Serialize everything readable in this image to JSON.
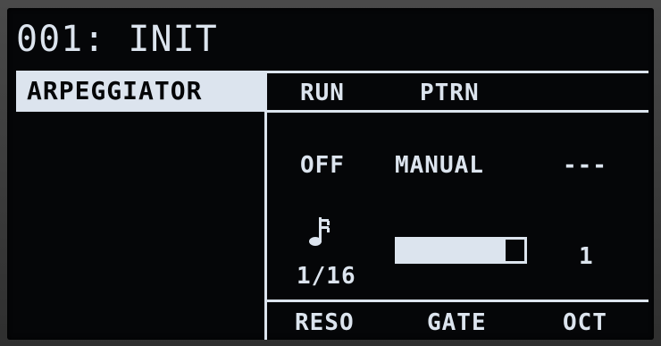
{
  "preset": {
    "title": "001: INIT"
  },
  "section": {
    "label": "ARPEGGIATOR"
  },
  "top_params": {
    "run_label": "RUN",
    "pattern_label": "PTRN",
    "run_value": "OFF",
    "pattern_value": "MANUAL",
    "third_value": "---"
  },
  "bottom_params": {
    "reso_label": "RESO",
    "gate_label": "GATE",
    "oct_label": "OCT",
    "reso_value": "1/16",
    "reso_icon": "sixteenth-note-icon",
    "gate_level": 0.85,
    "oct_value": "1"
  },
  "colors": {
    "screen_bg": "#050608",
    "foreground": "#dce4ee"
  }
}
